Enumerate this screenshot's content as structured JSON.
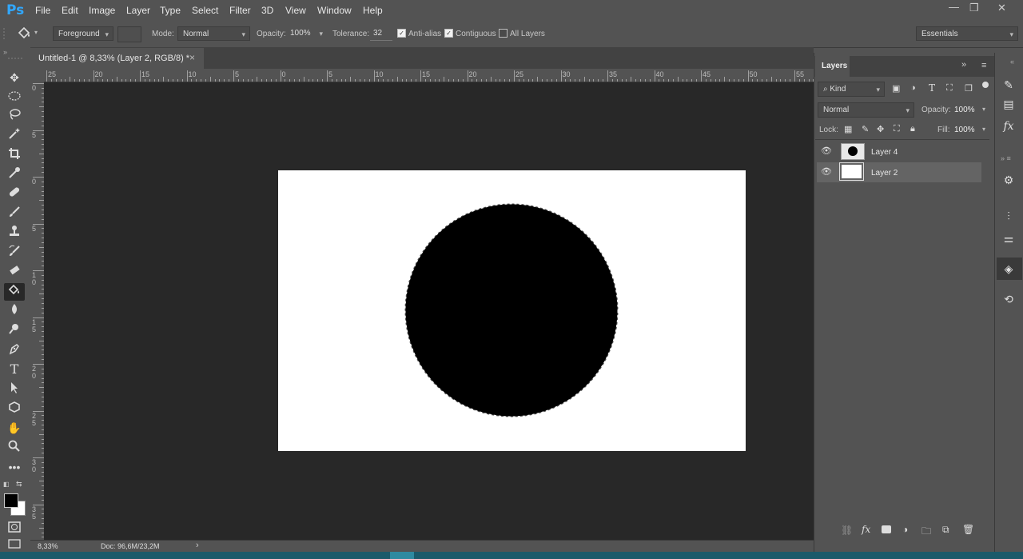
{
  "app": {
    "logo": "Ps"
  },
  "menu": [
    "File",
    "Edit",
    "Image",
    "Layer",
    "Type",
    "Select",
    "Filter",
    "3D",
    "View",
    "Window",
    "Help"
  ],
  "window_controls": {
    "minimize": "—",
    "restore": "❐",
    "close": "✕"
  },
  "options": {
    "fill_source": "Foreground",
    "mode_label": "Mode:",
    "mode_value": "Normal",
    "opacity_label": "Opacity:",
    "opacity_value": "100%",
    "tolerance_label": "Tolerance:",
    "tolerance_value": "32",
    "antialias_label": "Anti-alias",
    "antialias_checked": true,
    "contiguous_label": "Contiguous",
    "contiguous_checked": true,
    "alllayers_label": "All Layers",
    "alllayers_checked": false,
    "workspace": "Essentials"
  },
  "document": {
    "tab_title": "Untitled-1 @ 8,33% (Layer 2, RGB/8) *",
    "close": "×"
  },
  "ruler": {
    "h_ticks": [
      "25",
      "20",
      "15",
      "10",
      "5",
      "0",
      "5",
      "10",
      "15",
      "20",
      "25",
      "30",
      "35",
      "40",
      "45",
      "50",
      "55"
    ],
    "v_ticks": [
      "0",
      "5",
      "0",
      "5",
      "1 0",
      "1 5",
      "2 0",
      "2 5",
      "3 0",
      "3 5"
    ]
  },
  "status": {
    "zoom": "8,33%",
    "doc": "Doc: 96,6M/23,2M",
    "arrow": "›"
  },
  "layers_panel": {
    "title": "Layers",
    "filter_kind": "Kind",
    "blend_mode": "Normal",
    "opacity_label": "Opacity:",
    "opacity_value": "100%",
    "lock_label": "Lock:",
    "fill_label": "Fill:",
    "fill_value": "100%",
    "layers": [
      {
        "name": "Layer 4",
        "visible": true,
        "selected": false
      },
      {
        "name": "Layer 2",
        "visible": true,
        "selected": true
      }
    ]
  },
  "colors": {
    "canvas_bg": "#282828",
    "ui": "#535353",
    "selection": "#646464",
    "accent": "#31a8ff"
  }
}
